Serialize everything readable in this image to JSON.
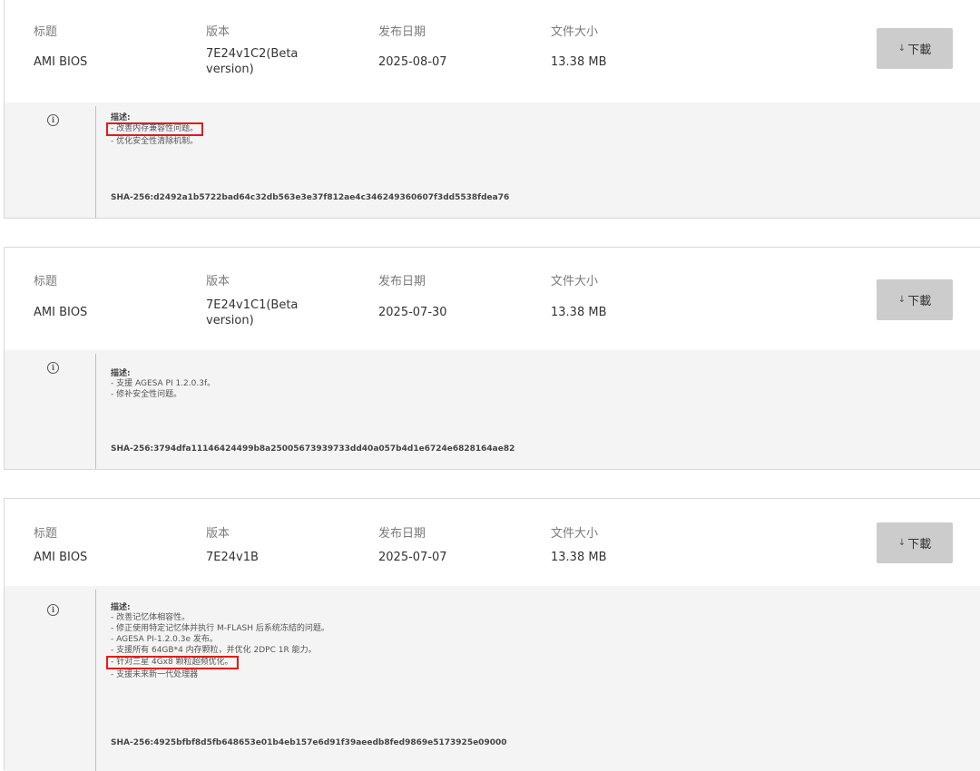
{
  "labels": {
    "title": "标题",
    "version": "版本",
    "date": "发布日期",
    "size": "文件大小",
    "download": "下載",
    "description": "描述:"
  },
  "colors": {
    "highlight": "#e01b1b",
    "button_bg": "#cccccc",
    "desc_bg": "#f4f4f4"
  },
  "bios": [
    {
      "title": "AMI BIOS",
      "version": "7E24v1C2(Beta version)",
      "date": "2025-08-07",
      "size": "13.38 MB",
      "desc": [
        "- 改善内存兼容性问题。",
        "- 优化安全性清除机制。"
      ],
      "sha": "SHA-256:d2492a1b5722bad64c32db563e3e37f812ae4c346249360607f3dd5538fdea76"
    },
    {
      "title": "AMI BIOS",
      "version": "7E24v1C1(Beta version)",
      "date": "2025-07-30",
      "size": "13.38 MB",
      "desc": [
        "- 支援 AGESA PI 1.2.0.3f。",
        "- 修补安全性问题。"
      ],
      "sha": "SHA-256:3794dfa11146424499b8a25005673939733dd40a057b4d1e6724e6828164ae82"
    },
    {
      "title": "AMI BIOS",
      "version": "7E24v1B",
      "date": "2025-07-07",
      "size": "13.38 MB",
      "desc": [
        "- 改善记忆体相容性。",
        "- 修正使用特定记忆体并执行 M-FLASH 后系统冻結的问题。",
        "- AGESA PI-1.2.0.3e 发布。",
        "- 支援所有 64GB*4 内存颗粒，并优化 2DPC 1R 能力。",
        "- 针对三星 4Gx8 颗粒超频优化。",
        "- 支援未来新一代处理器"
      ],
      "sha": "SHA-256:4925bfbf8d5fb648653e01b4eb157e6d91f39aeedb8fed9869e5173925e09000"
    }
  ]
}
